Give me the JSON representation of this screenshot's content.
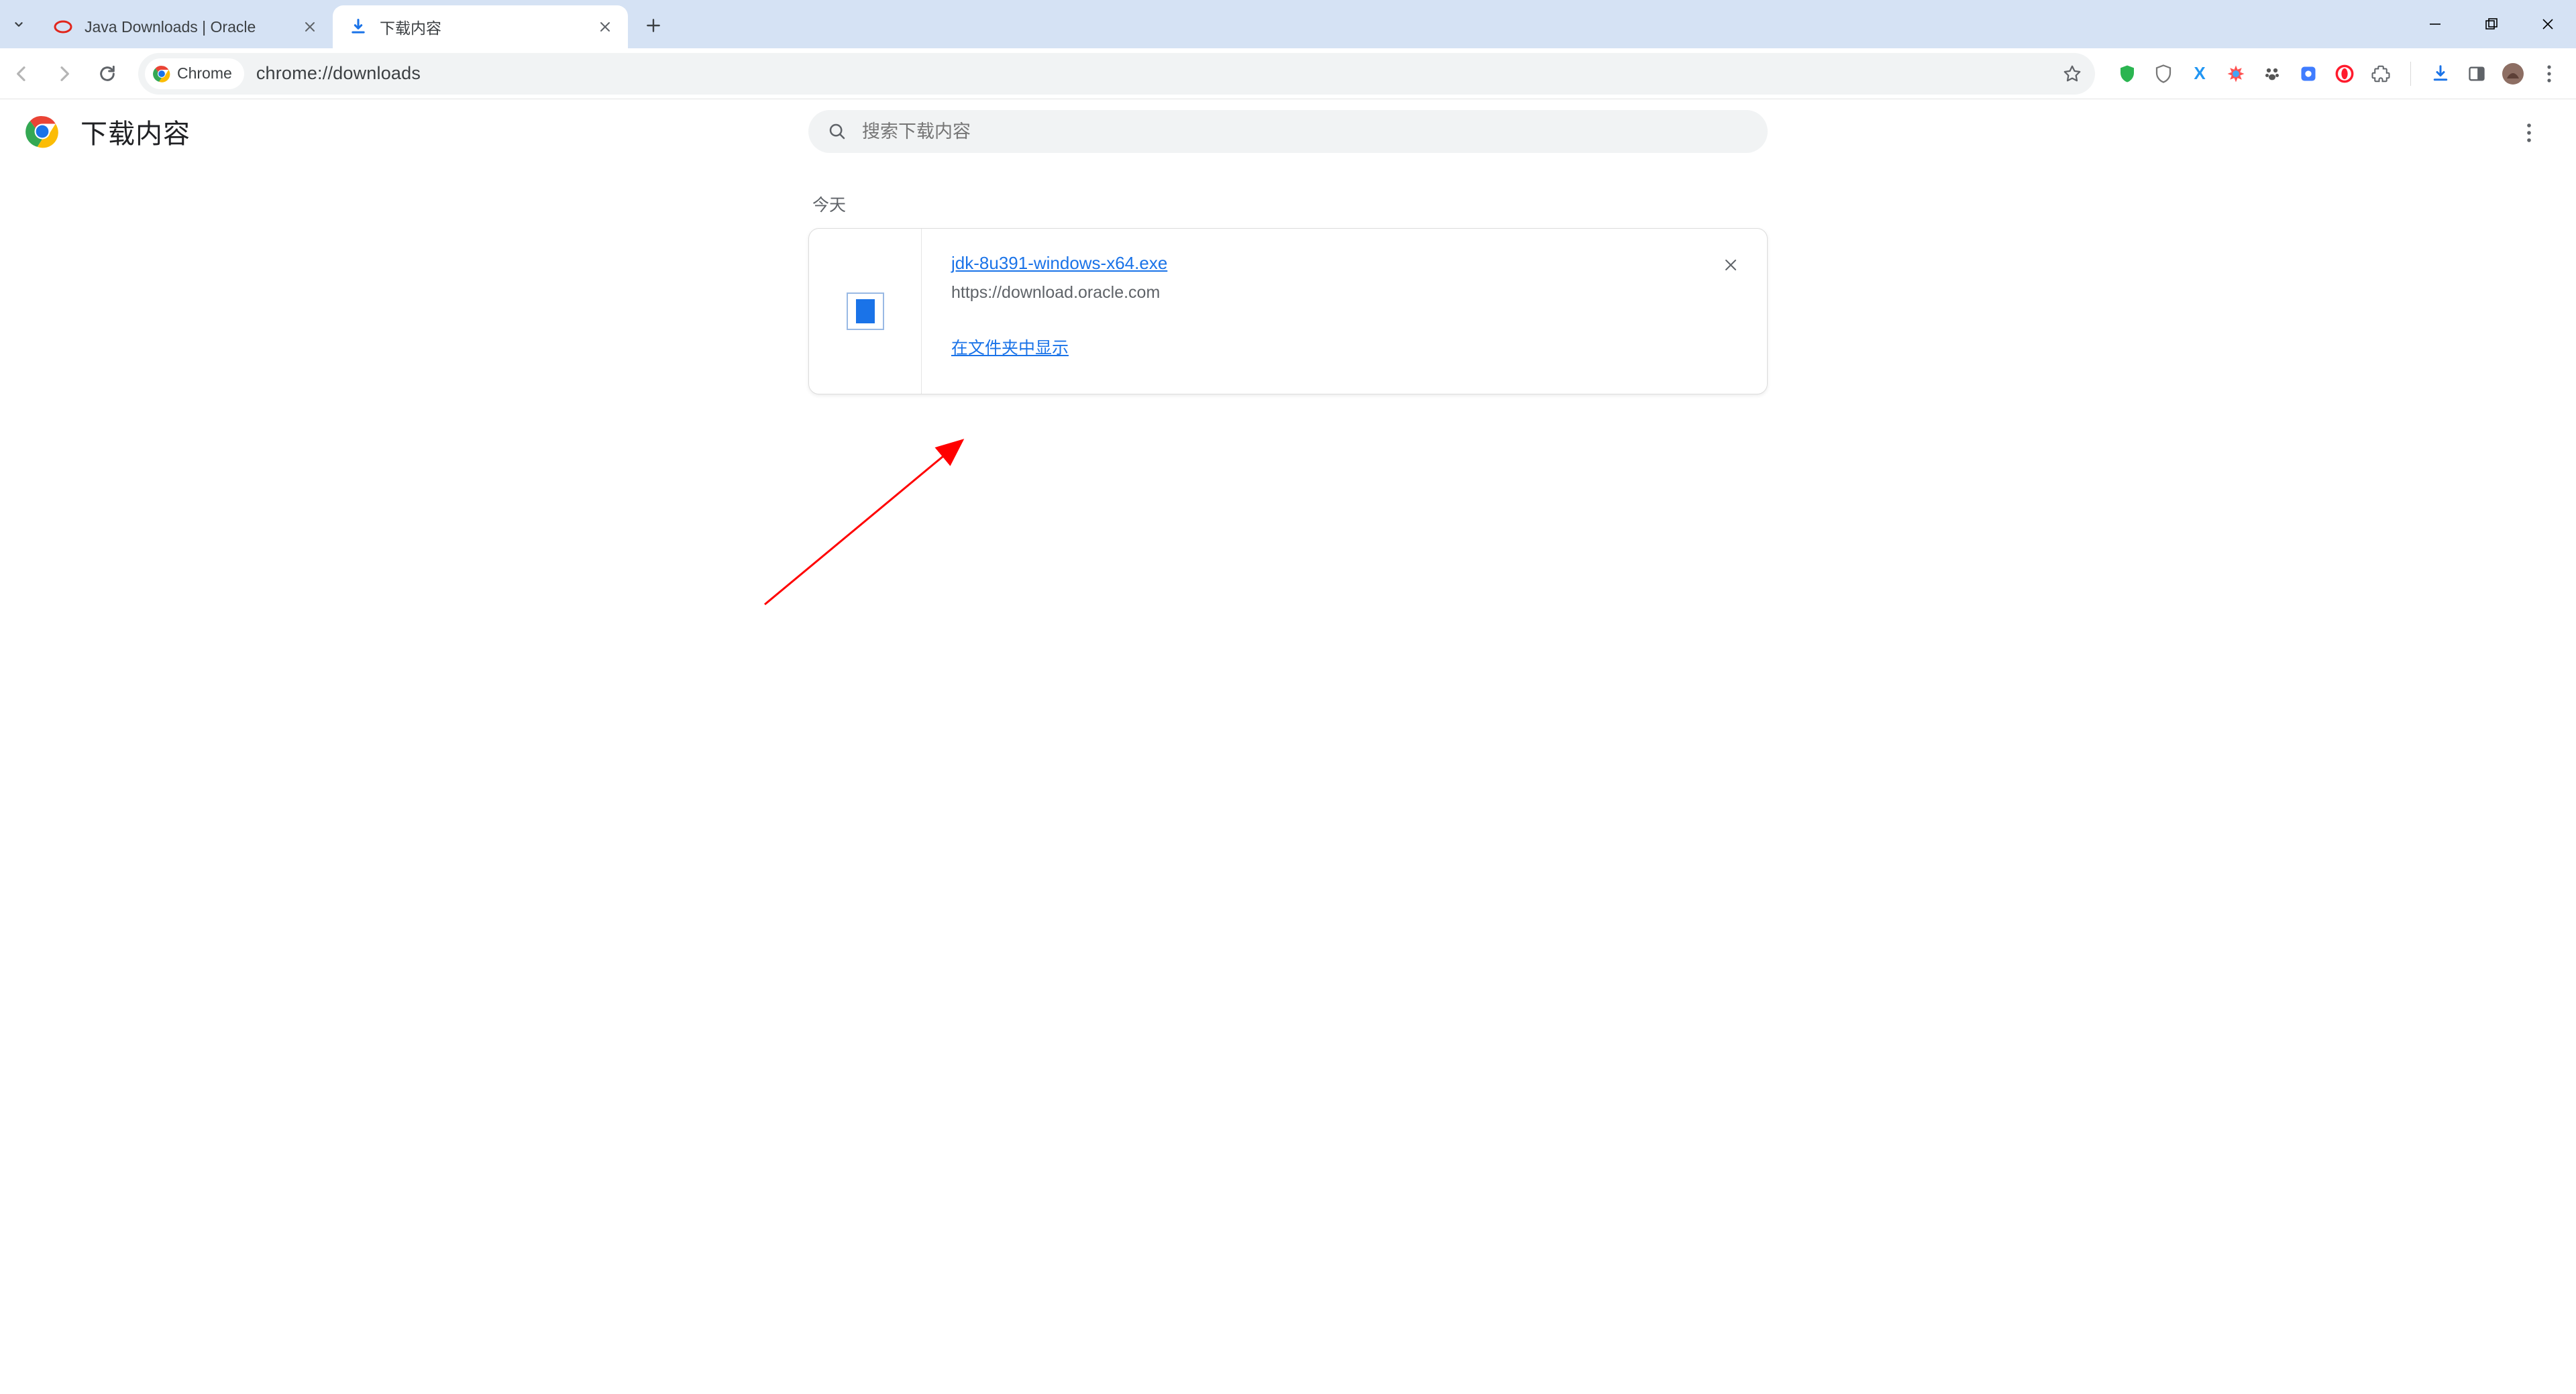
{
  "browser": {
    "tabs": [
      {
        "label": "Java Downloads | Oracle",
        "active": false
      },
      {
        "label": "下载内容",
        "active": true
      }
    ],
    "addressbar": {
      "chip": "Chrome",
      "url": "chrome://downloads"
    }
  },
  "page": {
    "title": "下载内容",
    "search_placeholder": "搜索下载内容",
    "date_group": "今天",
    "item": {
      "filename": "jdk-8u391-windows-x64.exe",
      "source": "https://download.oracle.com",
      "show_in_folder": "在文件夹中显示"
    }
  }
}
